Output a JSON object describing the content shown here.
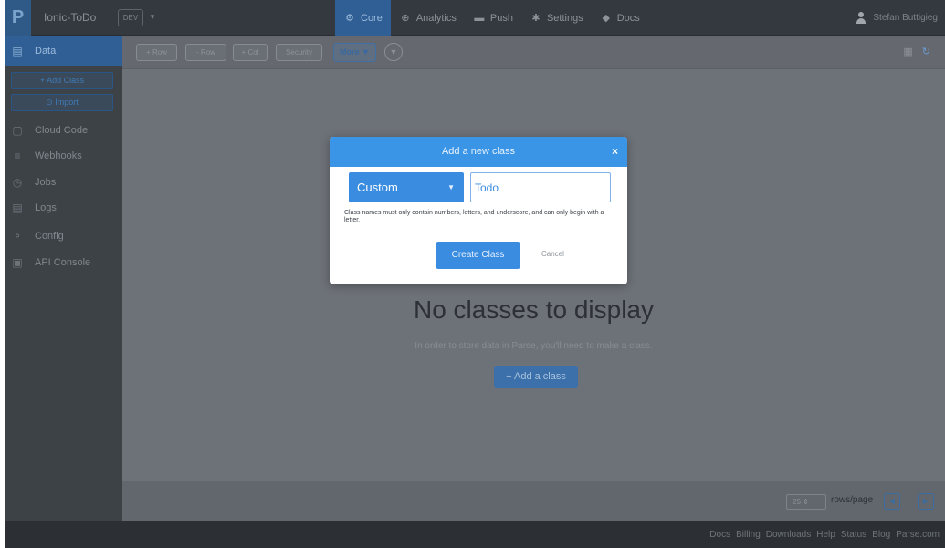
{
  "topbar": {
    "app_name": "Ionic-ToDo",
    "env": "DEV",
    "env_caret": "▼",
    "nav": [
      {
        "label": "Core",
        "icon": "core-icon",
        "glyph": "⚙",
        "active": true
      },
      {
        "label": "Analytics",
        "icon": "analytics-icon",
        "glyph": "⊕",
        "active": false
      },
      {
        "label": "Push",
        "icon": "push-icon",
        "glyph": "▬",
        "active": false
      },
      {
        "label": "Settings",
        "icon": "settings-icon",
        "glyph": "✱",
        "active": false
      },
      {
        "label": "Docs",
        "icon": "docs-icon",
        "glyph": "◆",
        "active": false
      }
    ],
    "user": "Stefan Buttigieg"
  },
  "sidebar": {
    "data_label": "Data",
    "add_class": "+ Add Class",
    "import": "⊙ Import",
    "items": [
      {
        "label": "Cloud Code",
        "icon": "cloud-code-icon",
        "glyph": "▢"
      },
      {
        "label": "Webhooks",
        "icon": "webhooks-icon",
        "glyph": "≡"
      },
      {
        "label": "Jobs",
        "icon": "jobs-icon",
        "glyph": "◷"
      },
      {
        "label": "Logs",
        "icon": "logs-icon",
        "glyph": "▤"
      },
      {
        "label": "Config",
        "icon": "config-icon",
        "glyph": "⚬"
      },
      {
        "label": "API Console",
        "icon": "api-console-icon",
        "glyph": "▣"
      }
    ]
  },
  "toolbar": {
    "add_row": "+ Row",
    "remove_row": "- Row",
    "add_col": "+ Col",
    "security": "Security",
    "more": "More ▼",
    "filter_glyph": "▼",
    "grid_glyph": "▦",
    "refresh_glyph": "↻"
  },
  "empty": {
    "title": "No classes to display",
    "subtitle": "In order to store data in Parse, you'll need to make a class.",
    "add_button": "+ Add a class"
  },
  "pager": {
    "rows_value": "25",
    "rows_label": "rows/page",
    "prev": "◀",
    "next": "▶"
  },
  "footer_links": [
    "Docs",
    "Billing",
    "Downloads",
    "Help",
    "Status",
    "Blog",
    "Parse.com"
  ],
  "modal": {
    "title": "Add a new class",
    "close": "×",
    "type_value": "Custom",
    "type_caret": "▼",
    "name_value": "Todo",
    "hint": "Class names must only contain numbers, letters, and underscore, and can only begin with a letter.",
    "create": "Create Class",
    "cancel": "Cancel"
  }
}
